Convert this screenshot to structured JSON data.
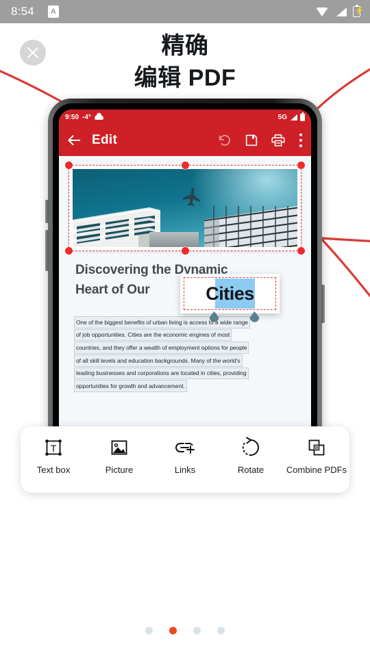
{
  "status_bar": {
    "time": "8:54",
    "app_badge": "A",
    "icons": [
      "wifi-icon",
      "signal-icon",
      "battery-charging-icon"
    ]
  },
  "close_button": {
    "icon": "close-icon"
  },
  "headline": {
    "line1": "精确",
    "line2": "编辑 PDF"
  },
  "colors": {
    "brand_red": "#CF2027",
    "accent_orange": "#EA4A1E",
    "arc_red": "#DC3838",
    "selection_blue": "#8ECBF2",
    "status_gray": "#9E9E9E"
  },
  "phone": {
    "inner_status": {
      "time": "9:50",
      "temperature": "-4°",
      "weather_icon": "cloud-icon",
      "network": "5G",
      "icons": [
        "signal-icon",
        "battery-icon"
      ]
    },
    "app_bar": {
      "back_icon": "back-arrow-icon",
      "title": "Edit",
      "actions": [
        {
          "name": "undo-icon",
          "label": "Undo",
          "disabled": true
        },
        {
          "name": "save-icon",
          "label": "Save",
          "disabled": false
        },
        {
          "name": "print-icon",
          "label": "Print",
          "disabled": false
        },
        {
          "name": "overflow-menu-icon",
          "label": "More",
          "disabled": false
        }
      ]
    },
    "document": {
      "image_block": {
        "alt": "airplane flying between two buildings",
        "selected": true,
        "handle_count": 6
      },
      "heading": "Discovering the Dynamic Heart of Our Cities",
      "heading_line1": "Discovering the Dynamic",
      "heading_line2": "Heart of Our",
      "edit_popup": {
        "word": "Cities",
        "selection_highlight": true,
        "handles": [
          "selection-handle-left",
          "selection-handle-right"
        ]
      },
      "paragraph_lines": [
        "One of the biggest benefits of urban living is access to a wide range",
        "of job opportunities. Cities are the economic engines of most",
        "countries, and they offer a wealth of employment options for people",
        "of all skill levels and education backgrounds. Many of the world's",
        "leading businesses and corporations are located in cities, providing",
        "opportunities for growth and advancement."
      ]
    }
  },
  "toolbar": {
    "items": [
      {
        "icon": "text-box-icon",
        "label": "Text box"
      },
      {
        "icon": "picture-icon",
        "label": "Picture"
      },
      {
        "icon": "links-icon",
        "label": "Links"
      },
      {
        "icon": "rotate-icon",
        "label": "Rotate"
      },
      {
        "icon": "combine-pdfs-icon",
        "label": "Combine PDFs"
      }
    ]
  },
  "pager": {
    "total": 4,
    "active_index": 1
  }
}
